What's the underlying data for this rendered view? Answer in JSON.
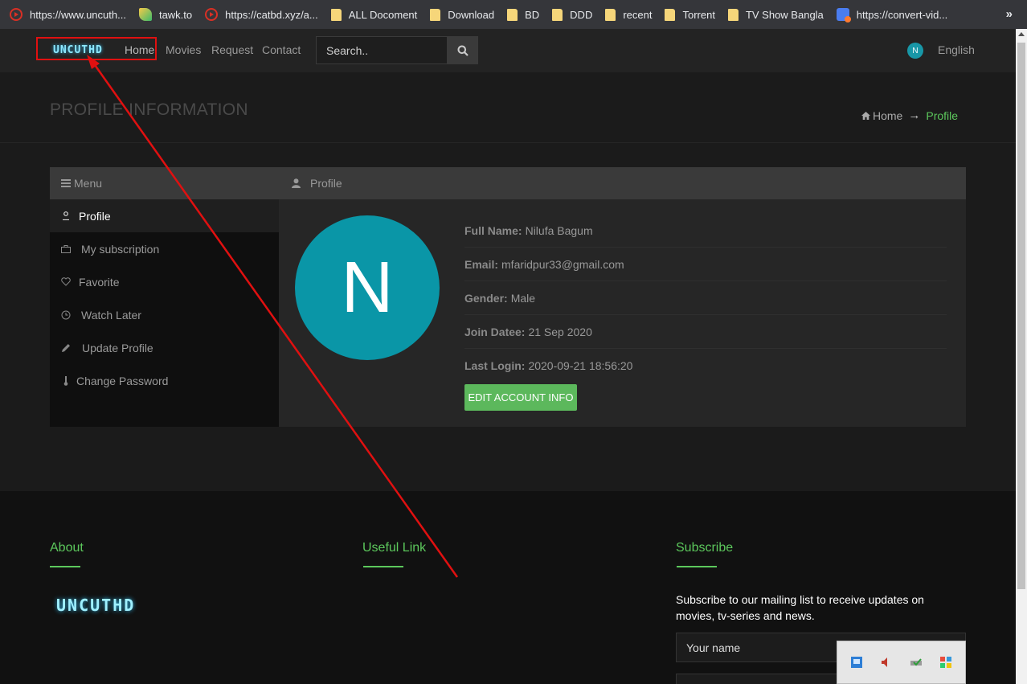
{
  "bookmarks": {
    "items": [
      {
        "label": "https://www.uncuth...",
        "icon": "youtube-icon"
      },
      {
        "label": "tawk.to",
        "icon": "tawk-icon"
      },
      {
        "label": "https://catbd.xyz/a...",
        "icon": "youtube-icon"
      },
      {
        "label": "ALL Docoment",
        "icon": "folder-icon"
      },
      {
        "label": "Download",
        "icon": "folder-icon"
      },
      {
        "label": "BD",
        "icon": "folder-icon"
      },
      {
        "label": "DDD",
        "icon": "folder-icon"
      },
      {
        "label": "recent",
        "icon": "folder-icon"
      },
      {
        "label": "Torrent",
        "icon": "folder-icon"
      },
      {
        "label": "TV Show Bangla",
        "icon": "folder-icon"
      },
      {
        "label": "https://convert-vid...",
        "icon": "video-icon"
      }
    ],
    "more": "»"
  },
  "navbar": {
    "logo": "UNCUTHD",
    "links": {
      "home": "Home",
      "movies": "Movies",
      "request": "Request",
      "contact": "Contact"
    },
    "search_placeholder": "Search..",
    "user_initial": "N",
    "language": "English"
  },
  "page_header": {
    "title": "PROFILE INFORMATION",
    "breadcrumb_home": "Home",
    "breadcrumb_arrow": "→",
    "breadcrumb_current": "Profile"
  },
  "menu": {
    "heading": "Menu",
    "items": {
      "profile": "Profile",
      "subscription": "My subscription",
      "favorite": "Favorite",
      "watch_later": "Watch Later",
      "update_profile": "Update Profile",
      "change_password": "Change Password"
    }
  },
  "profile": {
    "heading": "Profile",
    "avatar_initial": "N",
    "full_name_label": "Full Name:",
    "full_name": "Nilufa Bagum",
    "email_label": "Email:",
    "email": "mfaridpur33@gmail.com",
    "gender_label": "Gender:",
    "gender": "Male",
    "join_label": "Join Datee:",
    "join_date": "21 Sep 2020",
    "login_label": "Last Login:",
    "last_login": "2020-09-21 18:56:20",
    "edit_button": "EDIT ACCOUNT INFO"
  },
  "footer": {
    "about_title": "About",
    "useful_title": "Useful Link",
    "subscribe_title": "Subscribe",
    "logo": "UNCUTHD",
    "subscribe_text": "Subscribe to our mailing list to receive updates on movies, tv-series and news.",
    "name_placeholder": "Your name"
  },
  "colors": {
    "accent_green": "#5cc85c",
    "avatar_teal": "#0a96a7",
    "annotation_red": "#e01010"
  }
}
